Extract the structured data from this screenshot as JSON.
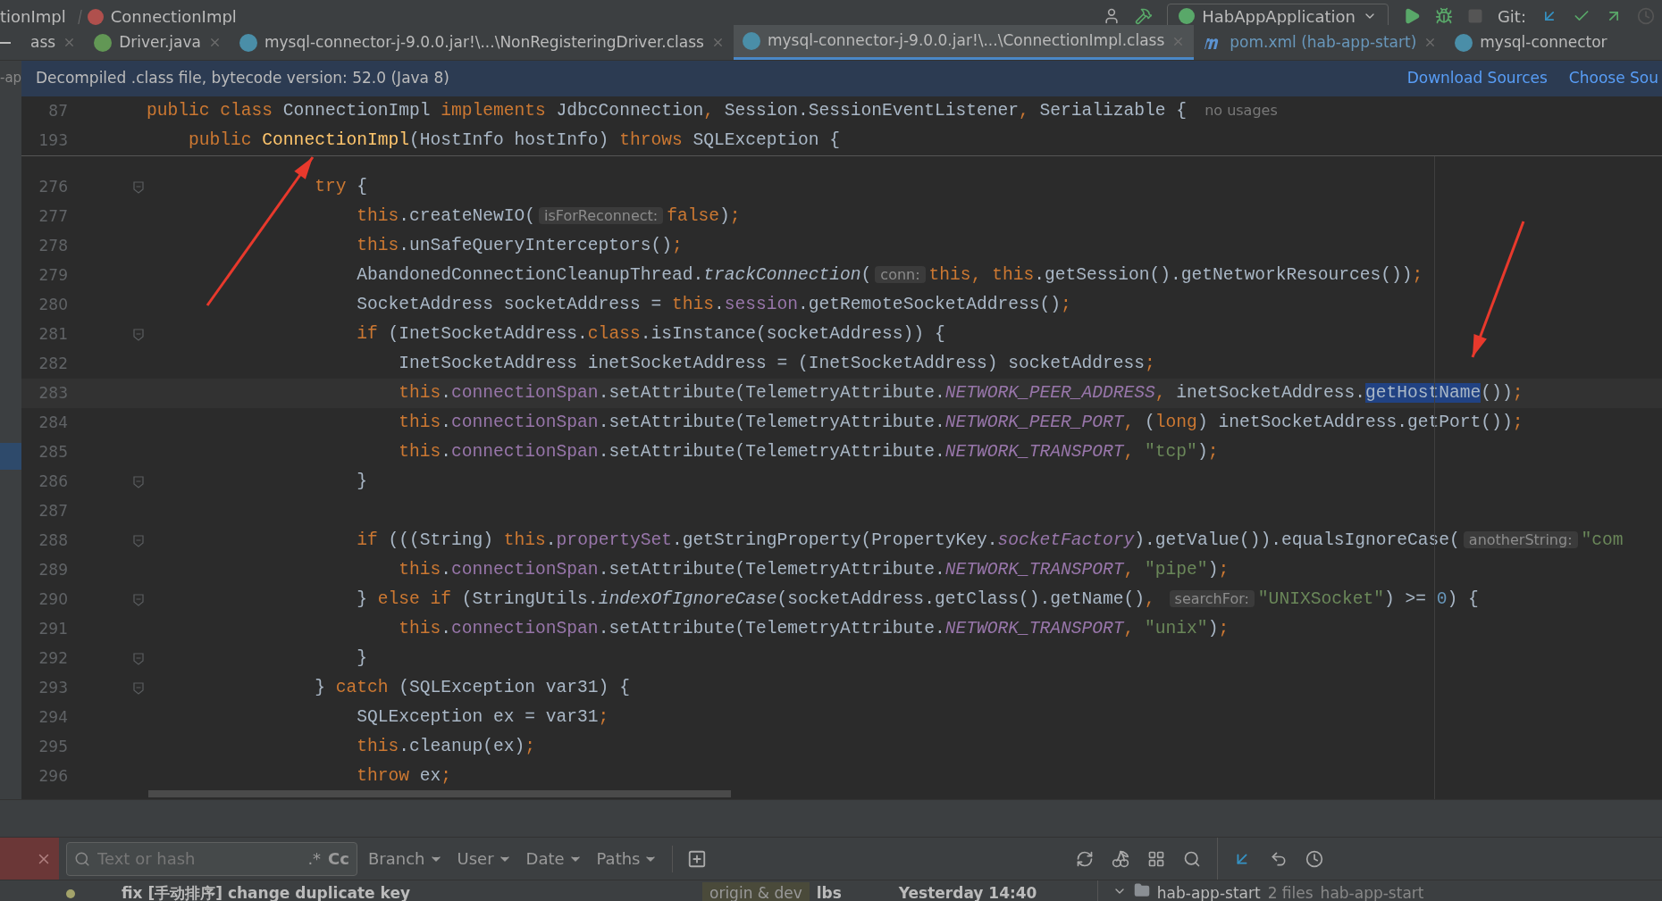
{
  "breadcrumb": {
    "items": [
      {
        "label": "tionImpl",
        "kind": "plain"
      },
      {
        "label": "ConnectionImpl",
        "kind": "method"
      }
    ]
  },
  "toolbar": {
    "run_config": "HabAppApplication",
    "vcs_label": "Git:"
  },
  "tabs": [
    {
      "label": "ass",
      "kind": "plain",
      "selected": false,
      "closable": true
    },
    {
      "label": "Driver.java",
      "kind": "interface",
      "selected": false,
      "closable": true
    },
    {
      "label": "mysql-connector-j-9.0.0.jar!\\...\\NonRegisteringDriver.class",
      "kind": "class",
      "selected": false,
      "closable": true
    },
    {
      "label": "mysql-connector-j-9.0.0.jar!\\...\\ConnectionImpl.class",
      "kind": "class",
      "selected": true,
      "closable": true
    },
    {
      "label": "pom.xml (hab-app-start)",
      "kind": "maven",
      "selected": false,
      "closable": true
    },
    {
      "label": "mysql-connector",
      "kind": "class",
      "selected": false,
      "closable": false
    }
  ],
  "side_label": "-ap",
  "banner": {
    "text": "Decompiled .class file, bytecode version: 52.0 (Java 8)",
    "links": [
      "Download Sources",
      "Choose Sou"
    ]
  },
  "sticky_lines": [
    {
      "number": "87",
      "tokens": [
        {
          "kind": "kw",
          "text": "public class "
        },
        {
          "kind": "plain",
          "text": "ConnectionImpl "
        },
        {
          "kind": "kw",
          "text": "implements "
        },
        {
          "kind": "plain",
          "text": "JdbcConnection"
        },
        {
          "kind": "punct",
          "text": ", "
        },
        {
          "kind": "plain",
          "text": "Session.SessionEventListener"
        },
        {
          "kind": "punct",
          "text": ", "
        },
        {
          "kind": "plain",
          "text": "Serializable {"
        },
        {
          "kind": "usage",
          "text": "no usages"
        }
      ]
    },
    {
      "number": "193",
      "tokens": [
        {
          "kind": "kw",
          "text": "    public "
        },
        {
          "kind": "fn",
          "text": "ConnectionImpl"
        },
        {
          "kind": "plain",
          "text": "(HostInfo hostInfo) "
        },
        {
          "kind": "kw",
          "text": "throws "
        },
        {
          "kind": "plain",
          "text": "SQLException {"
        }
      ]
    }
  ],
  "lines": [
    {
      "number": "276",
      "fold": true,
      "current": false,
      "tokens": [
        {
          "kind": "kw",
          "text": "                try "
        },
        {
          "kind": "plain",
          "text": "{"
        }
      ]
    },
    {
      "number": "277",
      "fold": false,
      "current": false,
      "tokens": [
        {
          "kind": "kw",
          "text": "                    this"
        },
        {
          "kind": "plain",
          "text": ".createNewIO("
        },
        {
          "kind": "hint",
          "text": "isForReconnect:"
        },
        {
          "kind": "kw",
          "text": "false"
        },
        {
          "kind": "plain",
          "text": ")"
        },
        {
          "kind": "punct",
          "text": ";"
        }
      ]
    },
    {
      "number": "278",
      "fold": false,
      "current": false,
      "tokens": [
        {
          "kind": "kw",
          "text": "                    this"
        },
        {
          "kind": "plain",
          "text": ".unSafeQueryInterceptors()"
        },
        {
          "kind": "punct",
          "text": ";"
        }
      ]
    },
    {
      "number": "279",
      "fold": false,
      "current": false,
      "tokens": [
        {
          "kind": "plain",
          "text": "                    AbandonedConnectionCleanupThread."
        },
        {
          "kind": "italic",
          "text": "trackConnection"
        },
        {
          "kind": "plain",
          "text": "("
        },
        {
          "kind": "hint",
          "text": "conn:"
        },
        {
          "kind": "kw",
          "text": "this"
        },
        {
          "kind": "punct",
          "text": ", "
        },
        {
          "kind": "kw",
          "text": "this"
        },
        {
          "kind": "plain",
          "text": ".getSession().getNetworkResources())"
        },
        {
          "kind": "punct",
          "text": ";"
        }
      ]
    },
    {
      "number": "280",
      "fold": false,
      "current": false,
      "tokens": [
        {
          "kind": "plain",
          "text": "                    SocketAddress socketAddress = "
        },
        {
          "kind": "kw",
          "text": "this"
        },
        {
          "kind": "plain",
          "text": "."
        },
        {
          "kind": "field",
          "text": "session"
        },
        {
          "kind": "plain",
          "text": ".getRemoteSocketAddress()"
        },
        {
          "kind": "punct",
          "text": ";"
        }
      ]
    },
    {
      "number": "281",
      "fold": true,
      "current": false,
      "tokens": [
        {
          "kind": "kw",
          "text": "                    if "
        },
        {
          "kind": "plain",
          "text": "(InetSocketAddress."
        },
        {
          "kind": "kw",
          "text": "class"
        },
        {
          "kind": "plain",
          "text": ".isInstance(socketAddress)) {"
        }
      ]
    },
    {
      "number": "282",
      "fold": false,
      "current": false,
      "tokens": [
        {
          "kind": "plain",
          "text": "                        InetSocketAddress inetSocketAddress = (InetSocketAddress) socketAddress"
        },
        {
          "kind": "punct",
          "text": ";"
        }
      ]
    },
    {
      "number": "283",
      "fold": false,
      "current": true,
      "tokens": [
        {
          "kind": "kw",
          "text": "                        this"
        },
        {
          "kind": "plain",
          "text": "."
        },
        {
          "kind": "field",
          "text": "connectionSpan"
        },
        {
          "kind": "plain",
          "text": ".setAttribute(TelemetryAttribute."
        },
        {
          "kind": "const",
          "text": "NETWORK_PEER_ADDRESS"
        },
        {
          "kind": "punct",
          "text": ", "
        },
        {
          "kind": "plain",
          "text": "inetSocketAddress."
        },
        {
          "kind": "selection",
          "text": "getHostName"
        },
        {
          "kind": "plain",
          "text": "())"
        },
        {
          "kind": "punct",
          "text": ";"
        }
      ]
    },
    {
      "number": "284",
      "fold": false,
      "current": false,
      "tokens": [
        {
          "kind": "kw",
          "text": "                        this"
        },
        {
          "kind": "plain",
          "text": "."
        },
        {
          "kind": "field",
          "text": "connectionSpan"
        },
        {
          "kind": "plain",
          "text": ".setAttribute(TelemetryAttribute."
        },
        {
          "kind": "const",
          "text": "NETWORK_PEER_PORT"
        },
        {
          "kind": "punct",
          "text": ", "
        },
        {
          "kind": "plain",
          "text": "("
        },
        {
          "kind": "kw",
          "text": "long"
        },
        {
          "kind": "plain",
          "text": ") inetSocketAddress.getPort())"
        },
        {
          "kind": "punct",
          "text": ";"
        }
      ]
    },
    {
      "number": "285",
      "fold": false,
      "current": false,
      "tokens": [
        {
          "kind": "kw",
          "text": "                        this"
        },
        {
          "kind": "plain",
          "text": "."
        },
        {
          "kind": "field",
          "text": "connectionSpan"
        },
        {
          "kind": "plain",
          "text": ".setAttribute(TelemetryAttribute."
        },
        {
          "kind": "const",
          "text": "NETWORK_TRANSPORT"
        },
        {
          "kind": "punct",
          "text": ", "
        },
        {
          "kind": "str",
          "text": "\"tcp\""
        },
        {
          "kind": "plain",
          "text": ")"
        },
        {
          "kind": "punct",
          "text": ";"
        }
      ]
    },
    {
      "number": "286",
      "fold": true,
      "current": false,
      "tokens": [
        {
          "kind": "plain",
          "text": "                    }"
        }
      ]
    },
    {
      "number": "287",
      "fold": false,
      "current": false
    },
    {
      "number": "288",
      "fold": true,
      "current": false,
      "tokens": [
        {
          "kind": "kw",
          "text": "                    if "
        },
        {
          "kind": "plain",
          "text": "(((String) "
        },
        {
          "kind": "kw",
          "text": "this"
        },
        {
          "kind": "plain",
          "text": "."
        },
        {
          "kind": "field",
          "text": "propertySet"
        },
        {
          "kind": "plain",
          "text": ".getStringProperty(PropertyKey."
        },
        {
          "kind": "const",
          "text": "socketFactory"
        },
        {
          "kind": "plain",
          "text": ").getValue()).equalsIgnoreCase("
        },
        {
          "kind": "hint",
          "text": "anotherString:"
        },
        {
          "kind": "str",
          "text": "\"com"
        }
      ]
    },
    {
      "number": "289",
      "fold": false,
      "current": false,
      "tokens": [
        {
          "kind": "kw",
          "text": "                        this"
        },
        {
          "kind": "plain",
          "text": "."
        },
        {
          "kind": "field",
          "text": "connectionSpan"
        },
        {
          "kind": "plain",
          "text": ".setAttribute(TelemetryAttribute."
        },
        {
          "kind": "const",
          "text": "NETWORK_TRANSPORT"
        },
        {
          "kind": "punct",
          "text": ", "
        },
        {
          "kind": "str",
          "text": "\"pipe\""
        },
        {
          "kind": "plain",
          "text": ")"
        },
        {
          "kind": "punct",
          "text": ";"
        }
      ]
    },
    {
      "number": "290",
      "fold": true,
      "current": false,
      "tokens": [
        {
          "kind": "plain",
          "text": "                    } "
        },
        {
          "kind": "kw",
          "text": "else if "
        },
        {
          "kind": "plain",
          "text": "(StringUtils."
        },
        {
          "kind": "italic",
          "text": "indexOfIgnoreCase"
        },
        {
          "kind": "plain",
          "text": "(socketAddress.getClass().getName()"
        },
        {
          "kind": "punct",
          "text": ", "
        },
        {
          "kind": "hint",
          "text": "searchFor:"
        },
        {
          "kind": "str",
          "text": "\"UNIXSocket\""
        },
        {
          "kind": "plain",
          "text": ") >= "
        },
        {
          "kind": "num",
          "text": "0"
        },
        {
          "kind": "plain",
          "text": ") {"
        }
      ]
    },
    {
      "number": "291",
      "fold": false,
      "current": false,
      "tokens": [
        {
          "kind": "kw",
          "text": "                        this"
        },
        {
          "kind": "plain",
          "text": "."
        },
        {
          "kind": "field",
          "text": "connectionSpan"
        },
        {
          "kind": "plain",
          "text": ".setAttribute(TelemetryAttribute."
        },
        {
          "kind": "const",
          "text": "NETWORK_TRANSPORT"
        },
        {
          "kind": "punct",
          "text": ", "
        },
        {
          "kind": "str",
          "text": "\"unix\""
        },
        {
          "kind": "plain",
          "text": ")"
        },
        {
          "kind": "punct",
          "text": ";"
        }
      ]
    },
    {
      "number": "292",
      "fold": true,
      "current": false,
      "tokens": [
        {
          "kind": "plain",
          "text": "                    }"
        }
      ]
    },
    {
      "number": "293",
      "fold": true,
      "current": false,
      "tokens": [
        {
          "kind": "plain",
          "text": "                } "
        },
        {
          "kind": "kw",
          "text": "catch "
        },
        {
          "kind": "plain",
          "text": "(SQLException var31) {"
        }
      ]
    },
    {
      "number": "294",
      "fold": false,
      "current": false,
      "tokens": [
        {
          "kind": "plain",
          "text": "                    SQLException ex = var31"
        },
        {
          "kind": "punct",
          "text": ";"
        }
      ]
    },
    {
      "number": "295",
      "fold": false,
      "current": false,
      "tokens": [
        {
          "kind": "kw",
          "text": "                    this"
        },
        {
          "kind": "plain",
          "text": ".cleanup(ex)"
        },
        {
          "kind": "punct",
          "text": ";"
        }
      ]
    },
    {
      "number": "296",
      "fold": false,
      "current": false,
      "tokens": [
        {
          "kind": "kw",
          "text": "                    throw "
        },
        {
          "kind": "plain",
          "text": "ex"
        },
        {
          "kind": "punct",
          "text": ";"
        }
      ]
    }
  ],
  "git_log": {
    "search_placeholder": "Text or hash",
    "regex_label": ".*",
    "case_label": "Cc",
    "filters": [
      "Branch",
      "User",
      "Date",
      "Paths"
    ],
    "commit": {
      "message": "fix [手动排序] change duplicate key",
      "refs": "origin & dev",
      "author": "lbs",
      "date": "Yesterday 14:40"
    },
    "changes": {
      "module": "hab-app-start",
      "count": "2 files",
      "path": "hab-app-start"
    }
  }
}
